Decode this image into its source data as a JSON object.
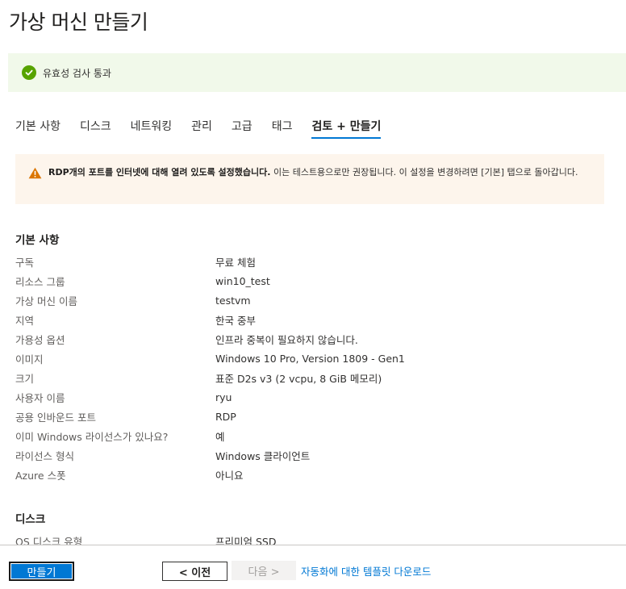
{
  "page_title": "가상 머신 만들기",
  "validation": {
    "text": "유효성 검사 통과",
    "color": "#57a300"
  },
  "tabs": [
    {
      "label": "기본 사항",
      "active": false
    },
    {
      "label": "디스크",
      "active": false
    },
    {
      "label": "네트워킹",
      "active": false
    },
    {
      "label": "관리",
      "active": false
    },
    {
      "label": "고급",
      "active": false
    },
    {
      "label": "태그",
      "active": false
    },
    {
      "label": "검토 + 만들기",
      "active": true
    }
  ],
  "warning": {
    "icon": "warning-triangle-icon",
    "bold": "RDP개의 포트를 인터넷에 대해 열려 있도록 설정했습니다.",
    "text": " 이는 테스트용으로만 권장됩니다.  이 설정을 변경하려면 [기본] 탭으로 돌아갑니다."
  },
  "basics": {
    "title": "기본 사항",
    "rows": [
      {
        "label": "구독",
        "value": "무료 체험"
      },
      {
        "label": "리소스 그룹",
        "value": "win10_test"
      },
      {
        "label": "가상 머신 이름",
        "value": "testvm"
      },
      {
        "label": "지역",
        "value": "한국 중부"
      },
      {
        "label": "가용성 옵션",
        "value": "인프라 중복이 필요하지 않습니다."
      },
      {
        "label": "이미지",
        "value": "Windows 10 Pro, Version 1809 - Gen1"
      },
      {
        "label": "크기",
        "value": "표준 D2s v3 (2 vcpu, 8 GiB 메모리)"
      },
      {
        "label": "사용자 이름",
        "value": "ryu"
      },
      {
        "label": "공용 인바운드 포트",
        "value": "RDP"
      },
      {
        "label": "이미 Windows 라이선스가 있나요?",
        "value": "예"
      },
      {
        "label": "라이선스 형식",
        "value": "Windows 클라이언트"
      },
      {
        "label": "Azure 스폿",
        "value": "아니요"
      }
    ]
  },
  "disks": {
    "title": "디스크",
    "rows": [
      {
        "label": "OS 디스크 유형",
        "value": "프리미엄 SSD"
      }
    ]
  },
  "footer": {
    "create_label": "만들기",
    "prev_label": "< 이전",
    "next_label": "다음 >",
    "download_link": "자동화에 대한 템플릿 다운로드"
  }
}
